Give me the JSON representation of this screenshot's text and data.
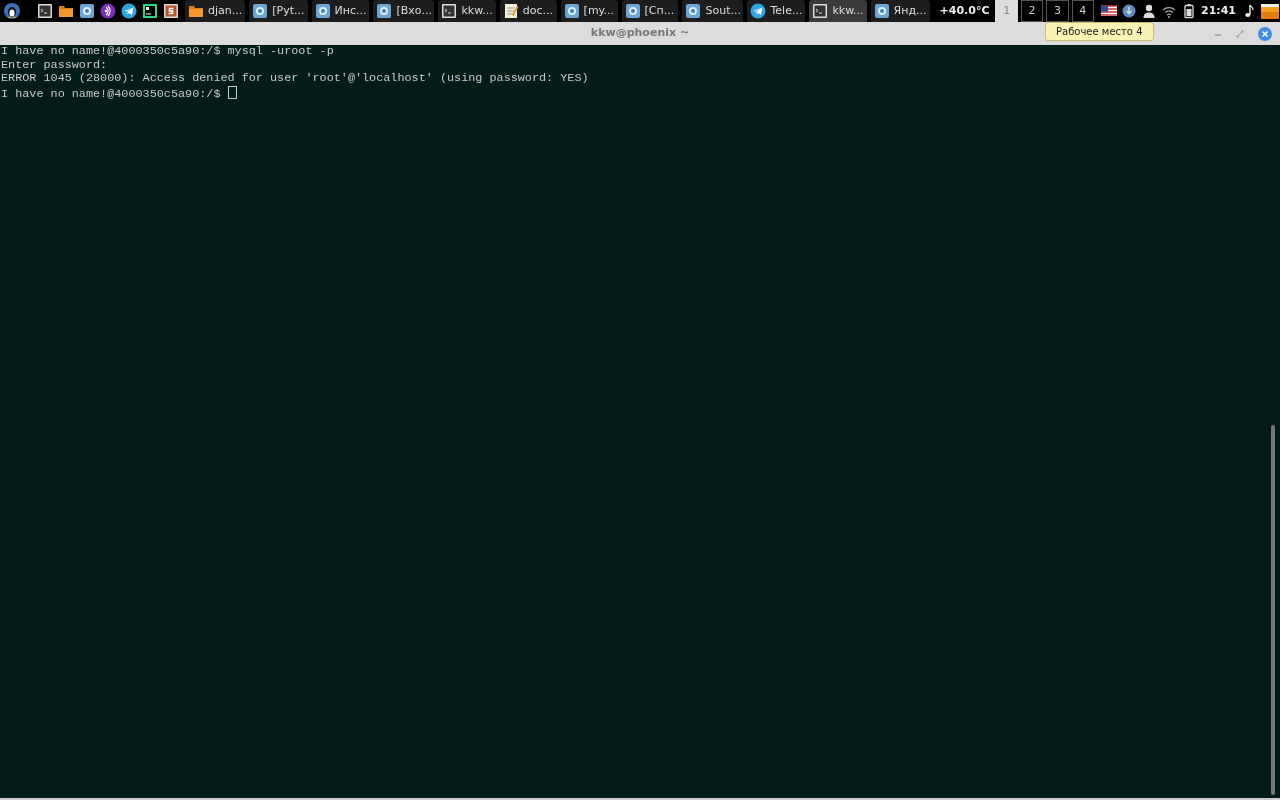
{
  "launchers": [
    {
      "kind": "menu"
    },
    {
      "kind": "terminal"
    },
    {
      "kind": "folder"
    },
    {
      "kind": "browser"
    },
    {
      "kind": "player"
    },
    {
      "kind": "telegram"
    },
    {
      "kind": "ide"
    },
    {
      "kind": "editor"
    }
  ],
  "tasks": [
    {
      "kind": "folder",
      "label": "djan...",
      "selected": false
    },
    {
      "kind": "browser",
      "label": "[Pyt...",
      "selected": false
    },
    {
      "kind": "browser",
      "label": "Инс...",
      "selected": false
    },
    {
      "kind": "browser",
      "label": "[Вхо...",
      "selected": false
    },
    {
      "kind": "terminal",
      "label": "kkw...",
      "selected": false
    },
    {
      "kind": "notepad",
      "label": "doc...",
      "selected": false
    },
    {
      "kind": "browser",
      "label": "[my...",
      "selected": false
    },
    {
      "kind": "browser",
      "label": "[Сп...",
      "selected": false
    },
    {
      "kind": "browser",
      "label": "Sout...",
      "selected": false
    },
    {
      "kind": "telegram",
      "label": "Tele...",
      "selected": false
    },
    {
      "kind": "terminal",
      "label": "kkw...",
      "selected": true
    },
    {
      "kind": "browser",
      "label": "Янд...",
      "selected": false
    }
  ],
  "temperature": "+40.0°C",
  "workspaces": [
    {
      "label": "1",
      "selected": true
    },
    {
      "label": "2",
      "selected": false
    },
    {
      "label": "3",
      "selected": false
    },
    {
      "label": "4",
      "selected": false
    }
  ],
  "tray": [
    {
      "kind": "flag"
    },
    {
      "kind": "update"
    },
    {
      "kind": "user"
    },
    {
      "kind": "wifi"
    },
    {
      "kind": "battery"
    }
  ],
  "clock": "21:41",
  "tray_end": [
    {
      "kind": "note"
    },
    {
      "kind": "desktop"
    }
  ],
  "tooltip": "Рабочее место 4",
  "window": {
    "title": "kkw@phoenix ~"
  },
  "terminal": {
    "lines": [
      "I have no name!@4000350c5a90:/$ mysql -uroot -p",
      "Enter password:",
      "ERROR 1045 (28000): Access denied for user 'root'@'localhost' (using password: YES)",
      "I have no name!@4000350c5a90:/$ "
    ]
  }
}
